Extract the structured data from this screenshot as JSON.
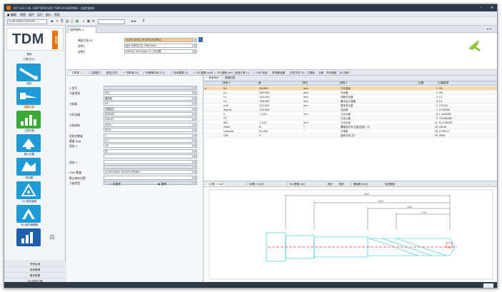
{
  "titlebar": {
    "title": "[AT V10 136 -SW-TDM2020] TDM SYSADMIN2 - [组件结构]",
    "minimize": "–",
    "close": "×"
  },
  "menu": [
    "● 编辑",
    "视图",
    "插件",
    "运行",
    "窗口",
    "帮助"
  ],
  "toolbar": {
    "combo": "CLGR-D0002-HOLEFL ⌄",
    "nav": "◄ ►",
    "help": "?"
  },
  "logo": {
    "brand": "TDM",
    "year": "2019"
  },
  "sidebar": {
    "section": "搜索",
    "section2": "刀具(中心)",
    "items": [
      {
        "label": "组件"
      },
      {
        "label": "装配刀具"
      },
      {
        "label": "刀具列表"
      },
      {
        "label": "输入设置"
      },
      {
        "label": "预设置"
      },
      {
        "label": "2D-图形编辑"
      },
      {
        "label": "3D-组件编辑器"
      }
    ],
    "bottom": [
      "所有区域",
      "批准管理",
      "基本数据",
      "TIS-研发刀具"
    ]
  },
  "main_tab": "组件结构 ×",
  "form": {
    "id_label": "装配刀具 ID",
    "id_value": "CLGR-D0002-HOLEFLATDRILL",
    "desc_label": "说明1",
    "desc_value": "钻头-可转位刀片 D36-4xDc",
    "desc2_label": "说明2",
    "desc2_value": "HSK-A/C 63-Capto C5 / 可乐钢"
  },
  "subtabs": [
    "✓ 主数据 1",
    "✓ 主数据 2",
    "报告/文件",
    "✓ 材料单 (4)",
    "✓ 存储单中间 (11)",
    "✓ 技术数据 (3)",
    "✓ 2D-图像 (dxf)",
    "✓ 3D-图像 (stl)",
    "检验订单 (1)",
    "✓ CAM 系统",
    "预设置设置",
    "历史文件 (0)",
    "刀具库",
    "仓库",
    "PDF图纸",
    "3D-切削"
  ],
  "leftform": {
    "rows": [
      {
        "label": "1 型号",
        "value": ""
      },
      {
        "label": "刀具类别",
        "value": "002"
      },
      {
        "label": "",
        "value": "通用钻"
      },
      {
        "label": "刀具组",
        "value": "04"
      },
      {
        "label": "",
        "value": "中要钻头"
      },
      {
        "label": "刀杆连接",
        "value": "HSK063"
      },
      {
        "label": "",
        "value": "HSK 63"
      },
      {
        "label": "刀具材料",
        "value": "4024"
      },
      {
        "label": "",
        "value": "4024"
      },
      {
        "label": "切削刃数量",
        "value": "1"
      },
      {
        "label": "重量 [kg]",
        "value": "2.7"
      },
      {
        "label": "状态 1",
        "value": "OK"
      },
      {
        "label": "",
        "value": "好"
      },
      {
        "label": "",
        "value": ""
      },
      {
        "label": "状态 2",
        "value": ""
      },
      {
        "label": "",
        "value": ""
      },
      {
        "label": "CAD-数量",
        "value": "CLGR-D0002-HOLEFLATDRILL"
      },
      {
        "label": "默认库存位置",
        "value": ""
      },
      {
        "label": "刀具类型",
        "value": ""
      }
    ],
    "radio1": "○ 非旋转",
    "radio2": "◉ 旋转"
  },
  "gridtabs": [
    "✓ 参考特征",
    "参数列表"
  ],
  "grid": {
    "headers": [
      "说明 1",
      "值",
      "单位",
      "说明 2",
      "位置",
      "功能类型"
    ],
    "rows": [
      [
        "Dc",
        "36.000",
        "mm",
        "刀片直径",
        "1",
        "DC"
      ],
      [
        "Ls",
        "285.000",
        "mm",
        "刃长度",
        "2",
        "XS"
      ],
      [
        "Lc",
        "144.000",
        "mm",
        "切削刃长度",
        "3",
        "LC"
      ],
      [
        "L4",
        "148.000",
        "mm",
        "最大加工深度",
        "4",
        "L4"
      ],
      [
        "Ltot",
        "225.000",
        "mm",
        "整体总长度",
        "5",
        "LTOTAL"
      ],
      [
        "Sigma",
        "176.000",
        "°",
        "顶尖角",
        "7",
        "A SIGMA"
      ],
      [
        "a",
        "1.120",
        "mm",
        "刀尖长度",
        "8",
        "L AKANSE"
      ],
      [
        "TT",
        "",
        "",
        "刀尖公差",
        "9",
        "TOLERANC"
      ],
      [
        "RE1",
        "1.200",
        "mm",
        "刀尖半径",
        "11",
        "R CORNER"
      ],
      [
        "Helix",
        "8",
        "°",
        "螺旋线方向 左旋/右旋 / 中",
        "16",
        "HELIX"
      ],
      [
        "Lambda",
        "20.000",
        "°",
        "刃倾角",
        "18",
        "A HELIX"
      ],
      [
        "CDL",
        "0",
        "",
        "旋转方向 左?",
        "20",
        "SPIN"
      ]
    ]
  },
  "drawtabs": [
    "✓ 2D图 1 (dxf)",
    "✓ 2D图 2 (dxf)",
    "✓ 3D-图像 (stl)",
    "网页",
    "网站",
    "✓ 基础图 (dxf)",
    "检查图纸"
  ],
  "drawing": {
    "dims": [
      "285",
      "244",
      "148",
      "176"
    ]
  }
}
